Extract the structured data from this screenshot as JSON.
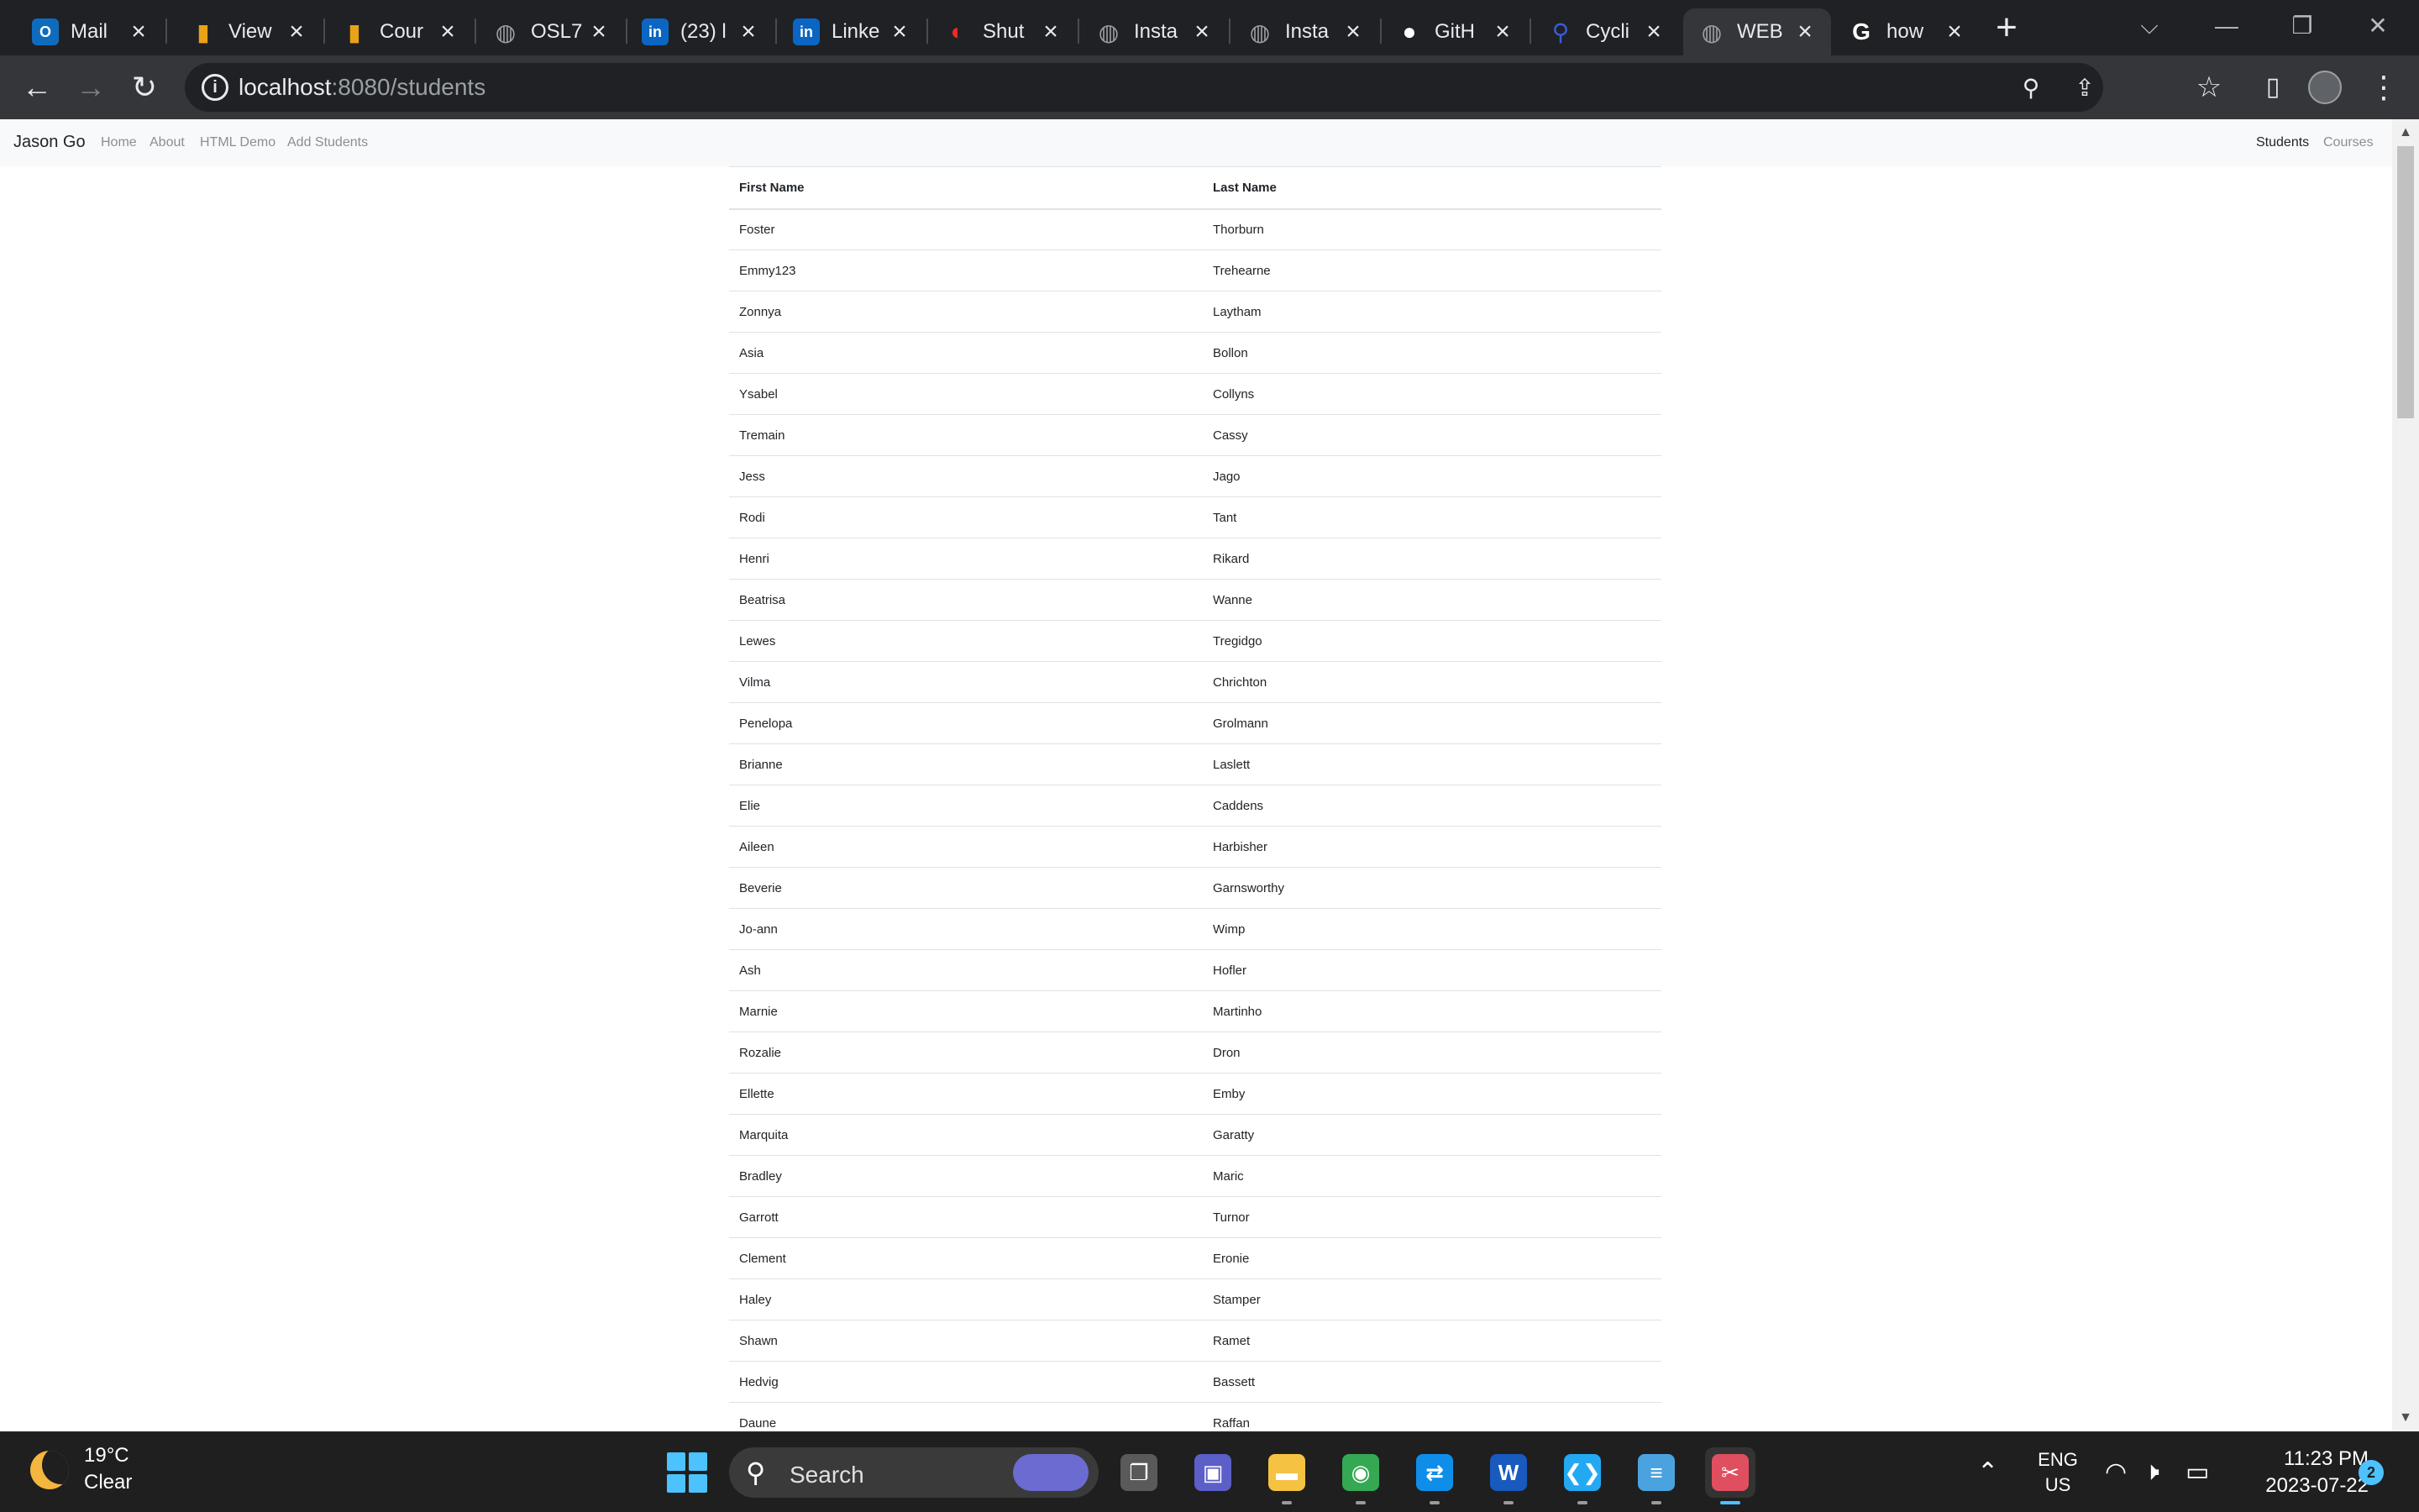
{
  "browser": {
    "tabs": [
      {
        "title": "Mail",
        "icon": "outlook-icon",
        "color": "#0f6cbd"
      },
      {
        "title": "View",
        "icon": "bar-chart-icon",
        "color": "#e8a317"
      },
      {
        "title": "Cour",
        "icon": "bar-chart-icon",
        "color": "#e8a317"
      },
      {
        "title": "OSL7",
        "icon": "globe-icon",
        "color": "#9aa0a6"
      },
      {
        "title": "(23) l",
        "icon": "linkedin-icon",
        "color": "#0a66c2"
      },
      {
        "title": "Linke",
        "icon": "linkedin-icon",
        "color": "#0a66c2"
      },
      {
        "title": "Shut",
        "icon": "shutterstock-icon",
        "color": "#ee2b24"
      },
      {
        "title": "Insta",
        "icon": "globe-icon",
        "color": "#9aa0a6"
      },
      {
        "title": "Insta",
        "icon": "globe-icon",
        "color": "#9aa0a6"
      },
      {
        "title": "GitH",
        "icon": "github-icon",
        "color": "#ffffff"
      },
      {
        "title": "Cycli",
        "icon": "cycling-icon",
        "color": "#3b5bdb"
      },
      {
        "title": "WEB",
        "icon": "globe-icon",
        "color": "#9aa0a6"
      },
      {
        "title": "how",
        "icon": "google-icon",
        "color": "#ffffff"
      }
    ],
    "url_host": "localhost",
    "url_path": ":8080/students"
  },
  "navbar": {
    "brand": "Jason Go",
    "links": [
      "Home",
      "About",
      "HTML Demo",
      "Add Students"
    ],
    "right_links": [
      "Students",
      "Courses"
    ]
  },
  "table": {
    "headers": [
      "First Name",
      "Last Name"
    ],
    "rows": [
      [
        "Foster",
        "Thorburn"
      ],
      [
        "Emmy123",
        "Trehearne"
      ],
      [
        "Zonnya",
        "Laytham"
      ],
      [
        "Asia",
        "Bollon"
      ],
      [
        "Ysabel",
        "Collyns"
      ],
      [
        "Tremain",
        "Cassy"
      ],
      [
        "Jess",
        "Jago"
      ],
      [
        "Rodi",
        "Tant"
      ],
      [
        "Henri",
        "Rikard"
      ],
      [
        "Beatrisa",
        "Wanne"
      ],
      [
        "Lewes",
        "Tregidgo"
      ],
      [
        "Vilma",
        "Chrichton"
      ],
      [
        "Penelopa",
        "Grolmann"
      ],
      [
        "Brianne",
        "Laslett"
      ],
      [
        "Elie",
        "Caddens"
      ],
      [
        "Aileen",
        "Harbisher"
      ],
      [
        "Beverie",
        "Garnsworthy"
      ],
      [
        "Jo-ann",
        "Wimp"
      ],
      [
        "Ash",
        "Hofler"
      ],
      [
        "Marnie",
        "Martinho"
      ],
      [
        "Rozalie",
        "Dron"
      ],
      [
        "Ellette",
        "Emby"
      ],
      [
        "Marquita",
        "Garatty"
      ],
      [
        "Bradley",
        "Maric"
      ],
      [
        "Garrott",
        "Turnor"
      ],
      [
        "Clement",
        "Eronie"
      ],
      [
        "Haley",
        "Stamper"
      ],
      [
        "Shawn",
        "Ramet"
      ],
      [
        "Hedvig",
        "Bassett"
      ],
      [
        "Daune",
        "Raffan"
      ]
    ]
  },
  "taskbar": {
    "weather_temp": "19°C",
    "weather_condition": "Clear",
    "search_label": "Search",
    "apps": [
      {
        "name": "task-view-icon",
        "color": "#5a5a5a"
      },
      {
        "name": "teams-chat-icon",
        "color": "#5b5fc7"
      },
      {
        "name": "file-explorer-icon",
        "color": "#f5c242"
      },
      {
        "name": "chrome-icon",
        "color": "#34a853"
      },
      {
        "name": "teamviewer-icon",
        "color": "#0e8ee9"
      },
      {
        "name": "word-icon",
        "color": "#185abd"
      },
      {
        "name": "vscode-icon",
        "color": "#23a9f2"
      },
      {
        "name": "notepad-icon",
        "color": "#4aa3df"
      },
      {
        "name": "snipping-tool-icon",
        "color": "#e04f5f"
      }
    ],
    "lang_line1": "ENG",
    "lang_line2": "US",
    "time": "11:23 PM",
    "date": "2023-07-22",
    "notification_count": "2"
  }
}
